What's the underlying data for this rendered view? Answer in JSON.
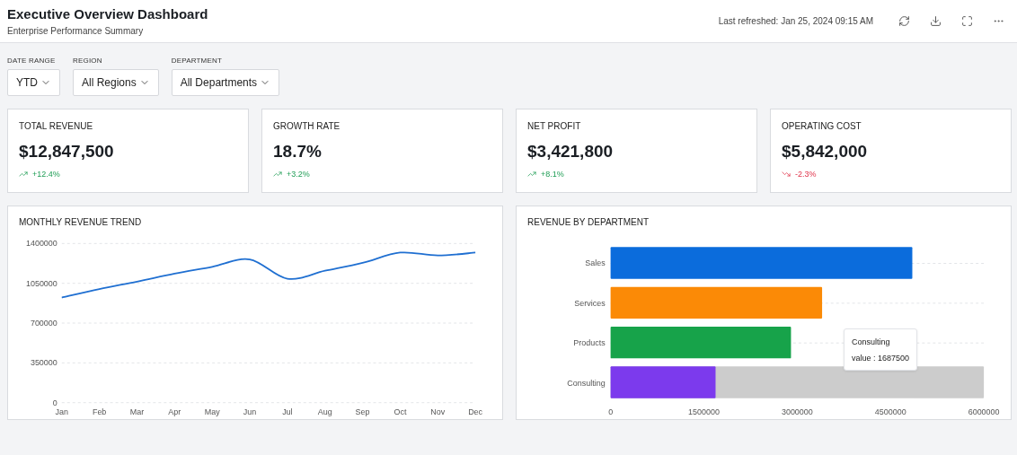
{
  "header": {
    "title": "Executive Overview Dashboard",
    "subtitle": "Enterprise Performance Summary",
    "last_refreshed": "Last refreshed: Jan 25, 2024 09:15 AM"
  },
  "filters": [
    {
      "label": "DATE RANGE",
      "value": "YTD"
    },
    {
      "label": "REGION",
      "value": "All Regions"
    },
    {
      "label": "DEPARTMENT",
      "value": "All Departments"
    }
  ],
  "kpis": [
    {
      "label": "TOTAL REVENUE",
      "value": "$12,847,500",
      "change": "+12.4%",
      "kind": "rise"
    },
    {
      "label": "GROWTH RATE",
      "value": "18.7%",
      "change": "+3.2%",
      "kind": "rise"
    },
    {
      "label": "NET PROFIT",
      "value": "$3,421,800",
      "change": "+8.1%",
      "kind": "rise"
    },
    {
      "label": "OPERATING COST",
      "value": "$5,842,000",
      "change": "-2.3%",
      "kind": "fall"
    }
  ],
  "revenue_trend": {
    "title": "MONTHLY REVENUE TREND",
    "chart_data": {
      "type": "line",
      "categories": [
        "Jan",
        "Feb",
        "Mar",
        "Apr",
        "May",
        "Jun",
        "Jul",
        "Aug",
        "Sep",
        "Oct",
        "Nov",
        "Dec"
      ],
      "series": [
        {
          "color": "#1f6fd1",
          "values": [
            925000,
            1000000,
            1065000,
            1135000,
            1195000,
            1260000,
            1090000,
            1160000,
            1230000,
            1320000,
            1295000,
            1320000
          ]
        }
      ],
      "ylim": [
        0,
        1400000
      ],
      "yticks": [
        0,
        350000,
        700000,
        1050000,
        1400000
      ],
      "grid": true
    }
  },
  "revenue_by_department": {
    "title": "REVENUE BY DEPARTMENT",
    "chart_data": {
      "type": "bar",
      "orientation": "horizontal",
      "categories": [
        "Sales",
        "Services",
        "Products",
        "Consulting"
      ],
      "series": [
        {
          "color": "#cccccc",
          "values": [
            null,
            null,
            null,
            6000000
          ]
        },
        {
          "color": "#0b6cdc",
          "values": [
            4850000,
            null,
            null,
            null
          ]
        },
        {
          "color": "#fb8a06",
          "values": [
            null,
            3400000,
            null,
            null
          ]
        },
        {
          "color": "#17a34a",
          "values": [
            null,
            null,
            2900000,
            null
          ]
        },
        {
          "color": "#7c3aed",
          "values": [
            null,
            null,
            null,
            1687500
          ]
        }
      ],
      "xlim": [
        0,
        6000000
      ],
      "xticks": [
        0,
        1500000,
        3000000,
        4500000,
        6000000
      ],
      "grid": true
    },
    "tooltip": {
      "title": "Consulting",
      "text": "value : 1687500"
    }
  }
}
